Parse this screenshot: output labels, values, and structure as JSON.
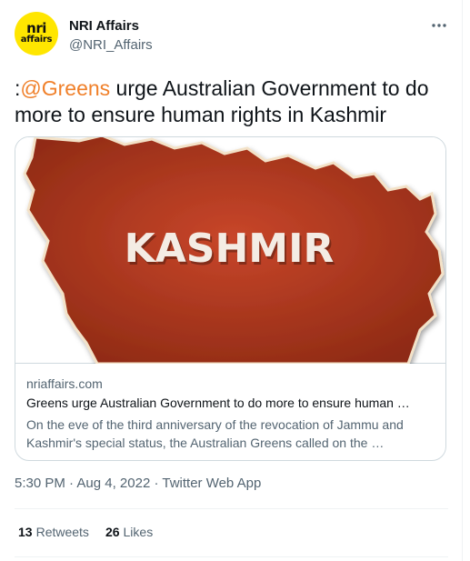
{
  "author": {
    "name": "NRI Affairs",
    "handle": "@NRI_Affairs",
    "avatar_line1": "nri",
    "avatar_line2": "affairs",
    "avatar_color": "#ffe600"
  },
  "more_icon": "more-dots-icon",
  "tweet": {
    "prefix": ":",
    "mention": "@Greens",
    "text": " urge Australian Government to do more to ensure human rights in Kashmir",
    "mention_color": "#f0802a"
  },
  "card": {
    "image_label": "KASHMIR",
    "image_color": "#b53a1f",
    "domain": "nriaffairs.com",
    "title": "Greens urge Australian Government to do more to ensure human …",
    "description": "On the eve of the third anniversary of the revocation of Jammu and Kashmir's special status, the Australian Greens called on the …"
  },
  "meta": {
    "time": "5:30 PM",
    "date": "Aug 4, 2022",
    "app": "Twitter Web App",
    "separator": " · "
  },
  "stats": {
    "retweets_count": "13",
    "retweets_label": "Retweets",
    "likes_count": "26",
    "likes_label": "Likes"
  }
}
